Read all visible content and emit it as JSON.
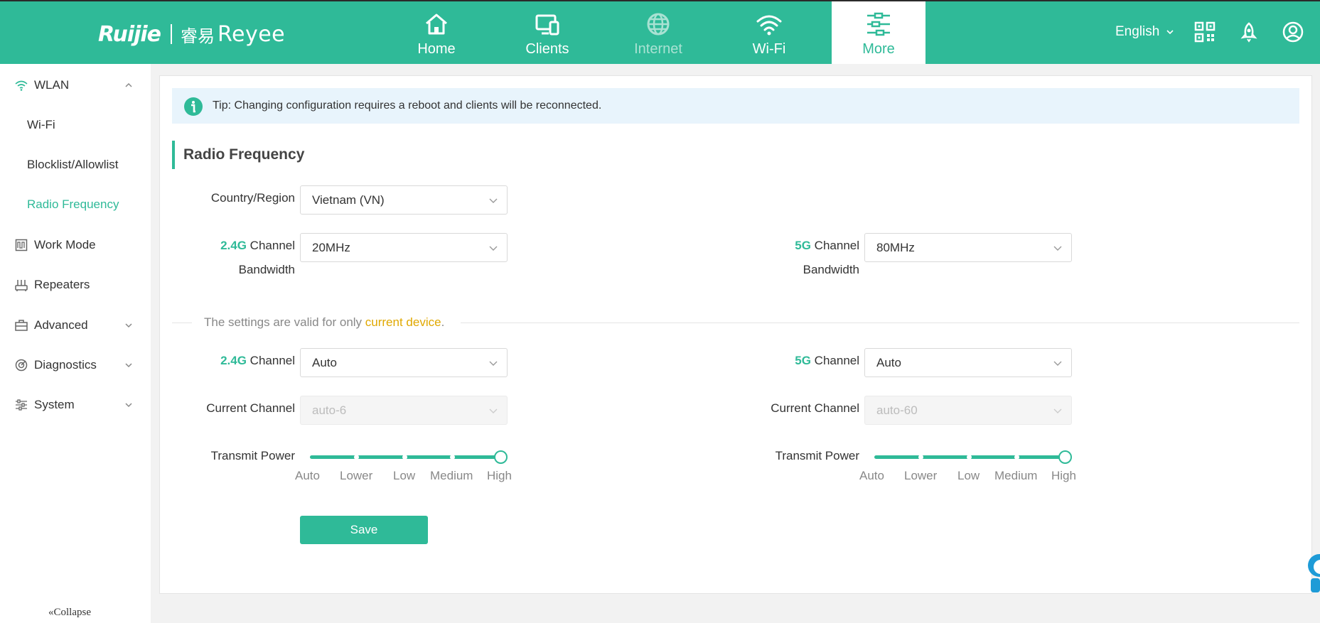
{
  "brand": {
    "primary": "Ruijie",
    "secondary": "Reyee",
    "mark": "睿易",
    "accent_color": "#2fba98",
    "header_color": "#2fba98"
  },
  "nav": {
    "items": [
      {
        "label": "Home",
        "icon": "home-icon"
      },
      {
        "label": "Clients",
        "icon": "clients-devices-icon"
      },
      {
        "label": "Internet",
        "icon": "globe-icon",
        "state": "disabled"
      },
      {
        "label": "Wi-Fi",
        "icon": "wifi-icon"
      },
      {
        "label": "More",
        "icon": "sliders-icon",
        "state": "active"
      }
    ]
  },
  "header": {
    "language": "English",
    "icons": [
      "qr-code-icon",
      "rocket-icon",
      "user-avatar-icon"
    ]
  },
  "sidebar": {
    "wlan": {
      "label": "WLAN",
      "icon": "wifi-icon",
      "expanded": true
    },
    "wlan_items": {
      "wifi": "Wi-Fi",
      "blocklist": "Blocklist/Allowlist",
      "radio_frequency": "Radio Frequency"
    },
    "work_mode": {
      "label": "Work Mode",
      "icon": "work-mode-icon"
    },
    "repeaters": {
      "label": "Repeaters",
      "icon": "repeater-icon"
    },
    "advanced": {
      "label": "Advanced",
      "icon": "toolbox-icon"
    },
    "diagnostics": {
      "label": "Diagnostics",
      "icon": "diagnostics-icon"
    },
    "system": {
      "label": "System",
      "icon": "system-sliders-icon"
    },
    "collapse_label": "Collapse",
    "active_item": "Radio Frequency"
  },
  "tip": {
    "text": "Tip: Changing configuration requires a reboot and clients will be reconnected."
  },
  "section": {
    "title": "Radio Frequency"
  },
  "form": {
    "country_region": {
      "label": "Country/Region",
      "value": "Vietnam (VN)"
    },
    "bandwidth_24": {
      "band": "2.4G",
      "label_rest": "Channel",
      "label_line2": "Bandwidth",
      "value": "20MHz"
    },
    "bandwidth_5": {
      "band": "5G",
      "label_rest": "Channel",
      "label_line2": "Bandwidth",
      "value": "80MHz"
    },
    "divider": {
      "prefix": "The settings are valid for only ",
      "highlight": "current device",
      "suffix": "."
    },
    "channel_24": {
      "band": "2.4G",
      "label_rest": "Channel",
      "value": "Auto"
    },
    "channel_5": {
      "band": "5G",
      "label_rest": "Channel",
      "value": "Auto"
    },
    "current_channel_24": {
      "label": "Current Channel",
      "value": "auto-6"
    },
    "current_channel_5": {
      "label": "Current Channel",
      "value": "auto-60"
    },
    "transmit_power_24": {
      "label": "Transmit Power",
      "value": "High",
      "level_index": 4
    },
    "transmit_power_5": {
      "label": "Transmit Power",
      "value": "High",
      "level_index": 4
    },
    "power_levels": [
      "Auto",
      "Lower",
      "Low",
      "Medium",
      "High"
    ],
    "save_label": "Save"
  }
}
